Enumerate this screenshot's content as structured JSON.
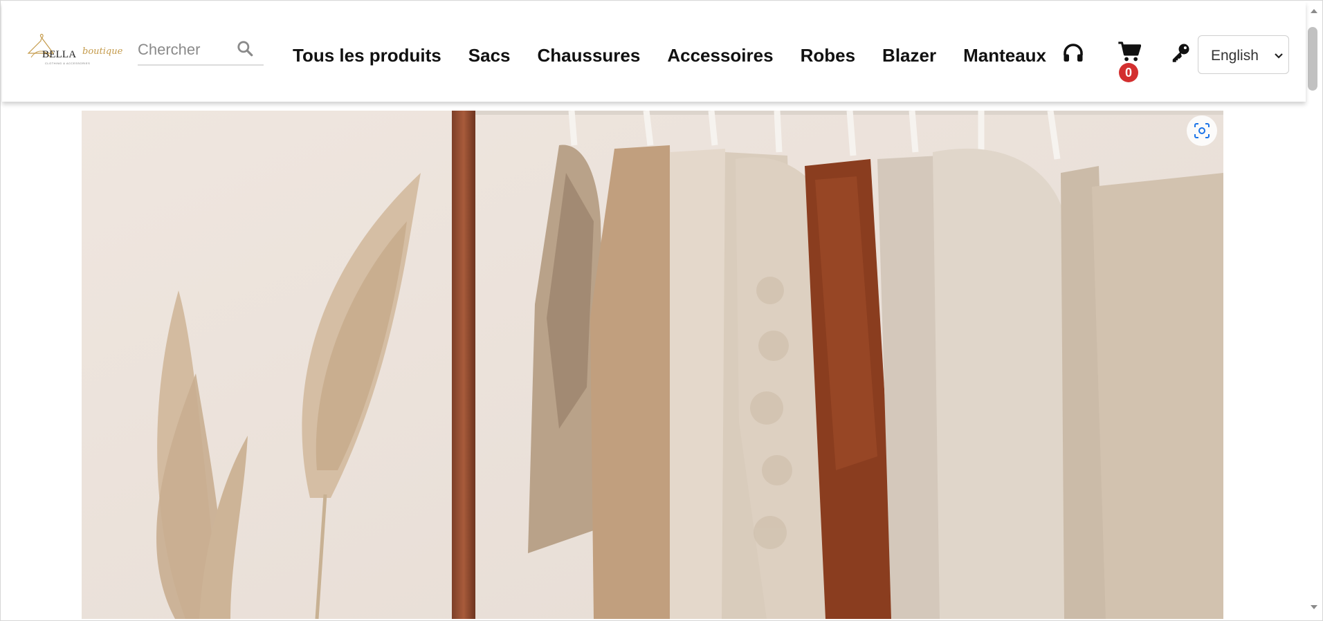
{
  "logo": {
    "brand": "BELLA",
    "brand_script": "boutique",
    "tagline": "CLOTHING & ACCESSORIES"
  },
  "search": {
    "placeholder": "Chercher",
    "value": ""
  },
  "nav": [
    {
      "label": "Tous les produits"
    },
    {
      "label": "Sacs"
    },
    {
      "label": "Chaussures"
    },
    {
      "label": "Accessoires"
    },
    {
      "label": "Robes"
    },
    {
      "label": "Blazer"
    },
    {
      "label": "Manteaux"
    }
  ],
  "header_icons": {
    "support": "headset-icon",
    "cart": "cart-icon",
    "login": "key-icon"
  },
  "cart": {
    "count": "0"
  },
  "language": {
    "selected": "English"
  },
  "hero": {
    "image": "clothing-rack-photo",
    "lens_icon": "visual-search-icon"
  },
  "colors": {
    "badge": "#d32f2f",
    "text": "#111111",
    "accent": "#1a73e8"
  }
}
